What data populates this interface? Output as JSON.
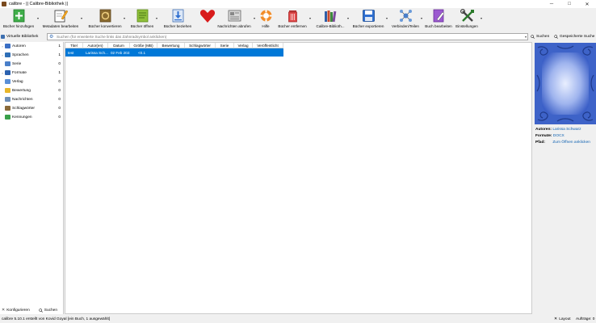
{
  "window": {
    "title": "calibre - || Calibre-Bibliothek ||",
    "controls": [
      "─",
      "□",
      "✕"
    ]
  },
  "toolbar": {
    "buttons": [
      {
        "label": "Bücher hinzufügen",
        "icon": "add-books-icon"
      },
      {
        "label": "Metadaten bearbeiten",
        "icon": "edit-metadata-icon"
      },
      {
        "label": "Bücher konvertieren",
        "icon": "convert-books-icon"
      },
      {
        "label": "Bücher öffnen",
        "icon": "view-books-icon"
      },
      {
        "label": "Bücher beziehen",
        "icon": "get-books-icon"
      },
      {
        "label": "Nachrichten abrufen",
        "icon": "fetch-news-icon"
      },
      {
        "label": "Hilfe",
        "icon": "help-icon"
      },
      {
        "label": "Bücher entfernen",
        "icon": "remove-books-icon"
      },
      {
        "label": "Calibre-Biblioth...",
        "icon": "library-icon"
      },
      {
        "label": "Bücher exportieren",
        "icon": "save-to-disk-icon"
      },
      {
        "label": "Verbinden/Teilen",
        "icon": "connect-share-icon"
      },
      {
        "label": "Buch bearbeiten",
        "icon": "edit-book-icon"
      },
      {
        "label": "Einstellungen",
        "icon": "preferences-icon"
      }
    ]
  },
  "search": {
    "virtual_library": "Virtuelle Bibliothek",
    "placeholder": "Suchen (für erweiterte Suche links das Zahnradsymbol anklicken)",
    "search_button": "Suchen",
    "saved_searches_button": "Gespeicherte Suche"
  },
  "tag_browser": {
    "items": [
      {
        "label": "Autoren",
        "count": "1",
        "expandable": true,
        "color": "#3b6fc4"
      },
      {
        "label": "Sprachen",
        "count": "1",
        "expandable": true,
        "color": "#2f6fb7"
      },
      {
        "label": "Serie",
        "count": "0",
        "expandable": false,
        "color": "#4a7fc9"
      },
      {
        "label": "Formate",
        "count": "1",
        "expandable": true,
        "color": "#2c62b0"
      },
      {
        "label": "Verlag",
        "count": "0",
        "expandable": false,
        "color": "#5a8fd6"
      },
      {
        "label": "Bewertung",
        "count": "0",
        "expandable": false,
        "color": "#e8b62a"
      },
      {
        "label": "Nachrichten",
        "count": "0",
        "expandable": false,
        "color": "#6e8fb8"
      },
      {
        "label": "Schlagwörter",
        "count": "0",
        "expandable": false,
        "color": "#8a6a3a"
      },
      {
        "label": "Kennungen",
        "count": "0",
        "expandable": false,
        "color": "#3aa04a"
      }
    ],
    "configure_button": "Konfigurieren",
    "find_button": "Suchen"
  },
  "book_list": {
    "columns": [
      "Titel",
      "Autor(en)",
      "Datum",
      "Größe (MB)",
      "Bewertung",
      "Schlagwörter",
      "Serie",
      "Verlag",
      "Veröffentlicht"
    ],
    "rows": [
      {
        "title": "test",
        "authors": "Larissa Sch...",
        "date": "02 Feb 2021",
        "size": "<0.1",
        "rating": "",
        "tags": "",
        "series": "",
        "publisher": "",
        "published": ""
      }
    ]
  },
  "book_details": {
    "authors_label": "Autoren:",
    "authors_value": "Larissa Schwarz",
    "formats_label": "Formate:",
    "formats_value": "DOCX",
    "path_label": "Pfad:",
    "path_value": "Zum Öffnen anklicken"
  },
  "status": {
    "left": "calibre 5.10.1 erstellt von Kovid Goyal   [ein Buch, 1 ausgewählt]",
    "layout_button": "Layout",
    "jobs": "Aufträge: 0"
  }
}
